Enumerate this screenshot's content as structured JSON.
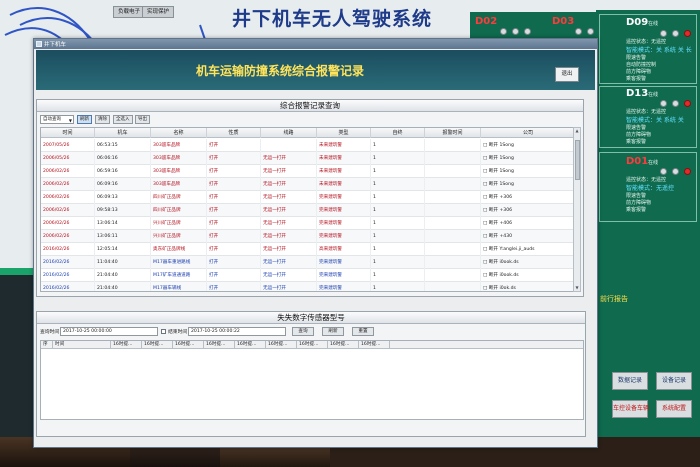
{
  "background": {
    "system_title": "井下机车无人驾驶系统",
    "top_buttons": [
      "负载电子",
      "实现保护"
    ],
    "stations": [
      {
        "id": "D09",
        "suffix": "在线",
        "lines": [
          "遥控状态：无遥控",
          "智能模式：关 系统 关 长",
          "限速告警",
          "自动防撞控制",
          "前方障碍物",
          "乘客报警"
        ]
      },
      {
        "id": "D13",
        "suffix": "在线",
        "lines": [
          "遥控状态：无遥控",
          "智能模式：关 系统 关",
          "限速告警",
          "前方障碍物",
          "乘客报警"
        ]
      },
      {
        "id": "D01",
        "suffix": "在线",
        "lines": [
          "遥控状态：无遥控",
          "智能模式：无遥控",
          "限速告警",
          "前方障碍物",
          "乘客报警"
        ]
      }
    ],
    "top_station_ids": [
      "D02",
      "D03"
    ],
    "yellow_label": "前行报告",
    "bottom_buttons": [
      "数据记录",
      "设备记录",
      "车控设备车辆",
      "系统配置"
    ]
  },
  "window": {
    "title": "井下机车",
    "header_title": "机车运输防撞系统综合报警记录",
    "exit_label": "退出"
  },
  "alarm_query": {
    "panel_title": "综合报警记录查询",
    "select_value": "自动查询",
    "buttons": [
      "刷新",
      "清除",
      "全选入",
      "导出"
    ],
    "columns": [
      "时间",
      "机车",
      "名称",
      "性质",
      "线路",
      "类型",
      "自终",
      "报警时间",
      "公司"
    ],
    "rows": [
      {
        "time": "2007/05/26",
        "loco": "06:53:15",
        "name": "303遥车品牌",
        "nature": "打开",
        "route": "",
        "type": "未来建筑警",
        "end": "1",
        "atime": "",
        "company": "□ 断开 1Song"
      },
      {
        "time": "2006/05/26",
        "loco": "06:06:16",
        "name": "303遥车品牌",
        "nature": "打开",
        "route": "无运一打开",
        "type": "未来建筑警",
        "end": "1",
        "atime": "",
        "company": "□ 断开 1Song"
      },
      {
        "time": "2006/02/26",
        "loco": "06:59:16",
        "name": "303遥车品牌",
        "nature": "打开",
        "route": "无运一打开",
        "type": "未来建筑警",
        "end": "1",
        "atime": "",
        "company": "□ 断开 1Song"
      },
      {
        "time": "2006/02/26",
        "loco": "06:09:16",
        "name": "303遥车品牌",
        "nature": "打开",
        "route": "无运一打开",
        "type": "未来建筑警",
        "end": "1",
        "atime": "",
        "company": "□ 断开 1Song"
      },
      {
        "time": "2006/02/26",
        "loco": "06:09:13",
        "name": "四川矿正品牌",
        "nature": "打开",
        "route": "无运一打开",
        "type": "完来建筑警",
        "end": "1",
        "atime": "",
        "company": "□ 断开 +306"
      },
      {
        "time": "2006/02/26",
        "loco": "09:58:13",
        "name": "四川矿正品牌",
        "nature": "打开",
        "route": "无运一打开",
        "type": "完来建筑警",
        "end": "1",
        "atime": "",
        "company": "□ 断开 +306"
      },
      {
        "time": "2006/02/26",
        "loco": "13:06:14",
        "name": "兴川矿正品牌",
        "nature": "打开",
        "route": "无运一打开",
        "type": "完来建筑警",
        "end": "1",
        "atime": "",
        "company": "□ 断开 +406"
      },
      {
        "time": "2006/02/26",
        "loco": "13:06:11",
        "name": "兴川矿正品牌",
        "nature": "打开",
        "route": "无运一打开",
        "type": "完来建筑警",
        "end": "1",
        "atime": "",
        "company": "□ 断开 +430"
      },
      {
        "time": "2016/02/26",
        "loco": "12:05:14",
        "name": "奥东矿正品牌线",
        "nature": "打开",
        "route": "无运一打开",
        "type": "高来建筑警",
        "end": "1",
        "atime": "",
        "company": "□ 断开 Y:anglei.ji_auds"
      },
      {
        "time": "2016/02/26",
        "loco": "11:04:40",
        "name": "M17器车重进路线",
        "nature": "打开",
        "route": "无运一打开",
        "type": "完来建筑警",
        "end": "1",
        "atime": "",
        "company": "□ 断开 i0ook.ds"
      },
      {
        "time": "2016/02/26",
        "loco": "21:04:40",
        "name": "M17矿车道通道路",
        "nature": "打开",
        "route": "无运一打开",
        "type": "完来建筑警",
        "end": "1",
        "atime": "",
        "company": "□ 断开 i0ook.ds"
      },
      {
        "time": "2016/02/26",
        "loco": "21:04:40",
        "name": "M17器车辆线",
        "nature": "打开",
        "route": "无运一打开",
        "type": "完来建筑警",
        "end": "1",
        "atime": "",
        "company": "□ 断开 i0ok.ds"
      }
    ]
  },
  "sensor_query": {
    "panel_title": "失失数字传感器型号",
    "start_label": "查询时间",
    "start_value": "2017-10-25   00:00:00",
    "end_label": "结束时间",
    "end_value": "2017-10-25   00:00:22",
    "buttons": [
      "查询",
      "刷新",
      "重置"
    ],
    "columns": [
      "序",
      "时间",
      "16时提...",
      "16时提...",
      "16时提...",
      "16时提...",
      "16时提...",
      "16时提...",
      "16时提...",
      "16时提...",
      "16时提..."
    ]
  }
}
